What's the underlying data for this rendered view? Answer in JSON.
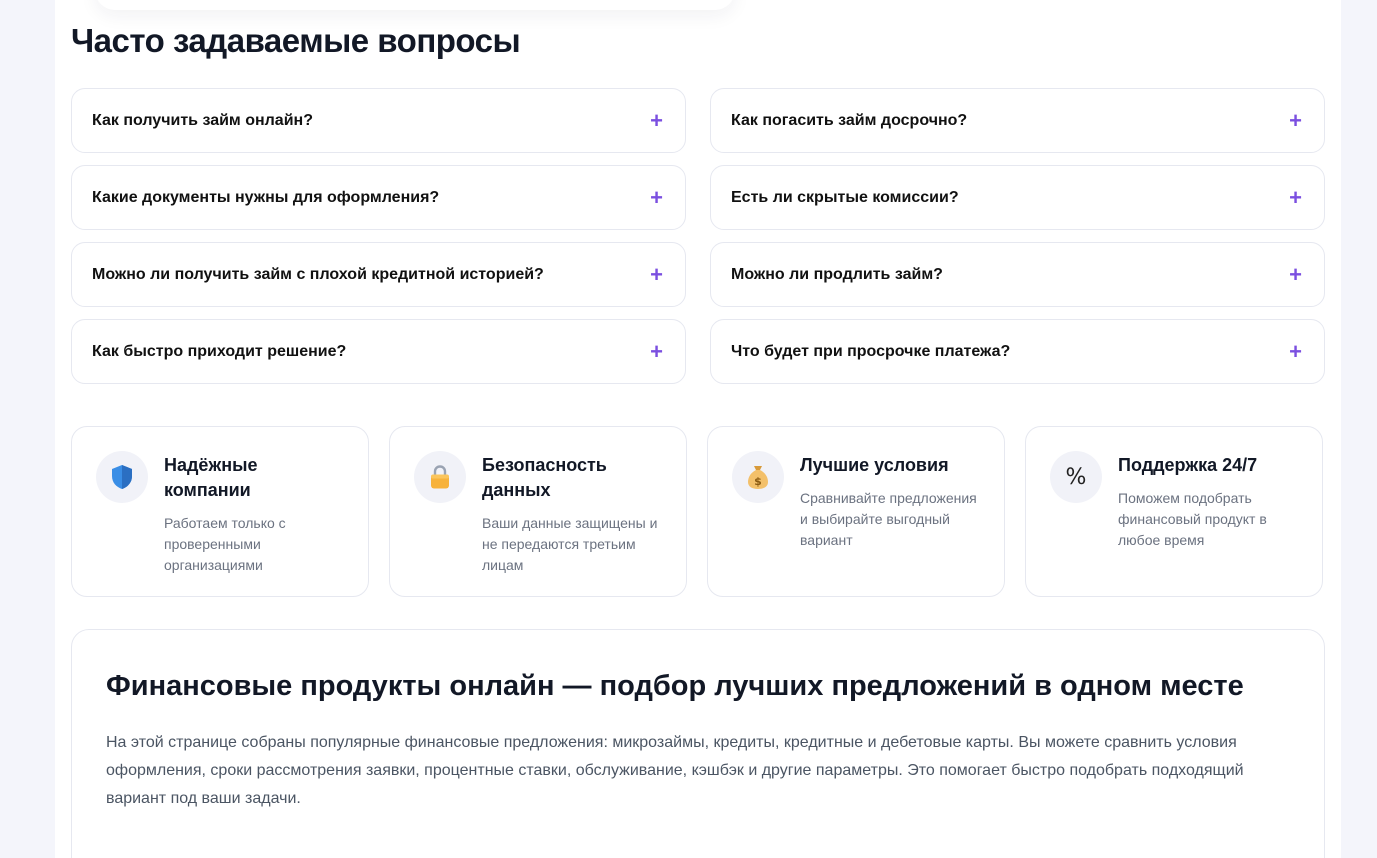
{
  "faq": {
    "title": "Часто задаваемые вопросы",
    "items": [
      {
        "question": "Как получить займ онлайн?"
      },
      {
        "question": "Как погасить займ досрочно?"
      },
      {
        "question": "Какие документы нужны для оформления?"
      },
      {
        "question": "Есть ли скрытые комиссии?"
      },
      {
        "question": "Можно ли получить займ с плохой кредитной историей?"
      },
      {
        "question": "Можно ли продлить займ?"
      },
      {
        "question": "Как быстро приходит решение?"
      },
      {
        "question": "Что будет при просрочке платежа?"
      }
    ],
    "expand_symbol": "+",
    "accent_color": "#7b4fe0"
  },
  "features": [
    {
      "icon": "shield-icon",
      "title": "Надёжные компании",
      "description": "Работаем только с проверенными организациями"
    },
    {
      "icon": "lock-icon",
      "title": "Безопасность данных",
      "description": "Ваши данные защищены и не передаются третьим лицам"
    },
    {
      "icon": "money-bag-icon",
      "title": "Лучшие условия",
      "description": "Сравнивайте предложения и выбирайте выгодный вариант"
    },
    {
      "icon": "percent-icon",
      "title": "Поддержка 24/7",
      "description": "Поможем подобрать финансовый продукт в любое время",
      "glyph": "%"
    }
  ],
  "info": {
    "title": "Финансовые продукты онлайн — подбор лучших предложений в одном месте",
    "text": "На этой странице собраны популярные финансовые предложения: микрозаймы, кредиты, кредитные и дебетовые карты. Вы можете сравнить условия оформления, сроки рассмотрения заявки, процентные ставки, обслуживание, кэшбэк и другие параметры. Это помогает быстро подобрать подходящий вариант под ваши задачи."
  }
}
